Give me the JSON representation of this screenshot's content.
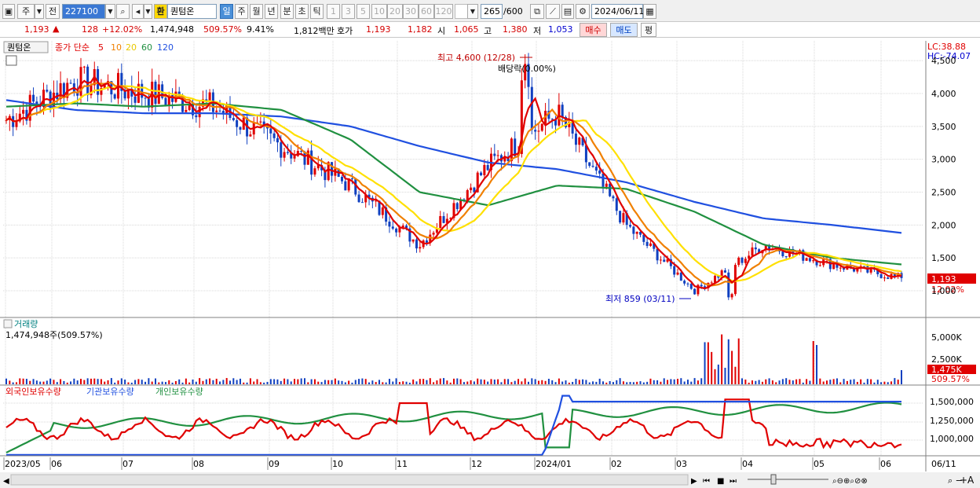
{
  "toolbar": {
    "type_label": "주",
    "prev_label": "전",
    "code_value": "227100",
    "cur_label": "환",
    "stock_name": "퀀텀온",
    "periods": [
      "일",
      "주",
      "월",
      "년",
      "분",
      "초",
      "틱"
    ],
    "selected_period": "일",
    "minutes": [
      "1",
      "3",
      "5",
      "10",
      "20",
      "30",
      "60",
      "120"
    ],
    "count_value": "265",
    "count_total": "/600",
    "date_value": "2024/06/11"
  },
  "quote": {
    "price": "1,193",
    "change": "128",
    "change_pct": "+12.02%",
    "volume": "1,474,948",
    "volume_ratio": "509.57%",
    "turnover": "9.41%",
    "amount": "1,812백만",
    "hoga_label": "호가",
    "ask": "1,193",
    "bid": "1,182",
    "open_label": "시",
    "open": "1,065",
    "high_label": "고",
    "high": "1,380",
    "low_label": "저",
    "low": "1,053",
    "buy_label": "매수",
    "sell_label": "매도",
    "eval_label": "평"
  },
  "price_panel": {
    "name_tag": "퀀텀온",
    "ma_label": "종가 단순",
    "ma_periods": [
      "5",
      "10",
      "20",
      "60",
      "120"
    ],
    "ma_colors": [
      "#e00000",
      "#f08000",
      "#ffe000",
      "#209040",
      "#2050e0"
    ],
    "lc_label": "LC:38.88",
    "hc_label": "HC:-74.07",
    "high_note": "최고 4,600 (12/28)",
    "dividend_note": "배당락(0.00%)",
    "low_note": "최저 859 (03/11)",
    "price_badge": "1,193",
    "pct_badge": "12.02%",
    "y_ticks": [
      "4,500",
      "4,000",
      "3,500",
      "3,000",
      "2,500",
      "2,000",
      "1,500",
      "1,000"
    ]
  },
  "volume_panel": {
    "title": "거래량",
    "value": "1,474,948주(509.57%)",
    "y_ticks": [
      "5,000K",
      "2,500K"
    ],
    "badge": "1,475K",
    "badge_pct": "509.57%"
  },
  "holding_panel": {
    "legend": [
      "외국인보유수량",
      "기관보유수량",
      "개인보유수량"
    ],
    "colors": [
      "#e00000",
      "#2050e0",
      "#209040"
    ],
    "y_ticks": [
      "1,500,000",
      "1,250,000",
      "1,000,000"
    ]
  },
  "x_axis": {
    "labels": [
      "2023/05",
      "06",
      "07",
      "08",
      "09",
      "10",
      "11",
      "12",
      "2024/01",
      "02",
      "03",
      "04",
      "05",
      "06"
    ],
    "right_label": "06/11"
  },
  "chart_data": {
    "type": "line",
    "title": "",
    "x": [
      "2023/05",
      "2023/06",
      "2023/07",
      "2023/08",
      "2023/09",
      "2023/10",
      "2023/11",
      "2023/12",
      "2024/01",
      "2024/02",
      "2024/03",
      "2024/04",
      "2024/05",
      "2024/06"
    ],
    "series": [
      {
        "name": "종가 단순 5",
        "values": [
          3600,
          4200,
          4000,
          3800,
          3200,
          2600,
          1700,
          2900,
          3700,
          2000,
          1000,
          1700,
          1400,
          1193
        ]
      },
      {
        "name": "종가 단순 60",
        "values": [
          3800,
          3850,
          3800,
          3850,
          3750,
          3300,
          2500,
          2300,
          2600,
          2550,
          2200,
          1700,
          1500,
          1400
        ]
      },
      {
        "name": "종가 단순 120",
        "values": [
          3900,
          3750,
          3700,
          3700,
          3650,
          3500,
          3200,
          2950,
          2850,
          2650,
          2350,
          2100,
          2000,
          1880
        ]
      }
    ],
    "price_range": [
      859,
      4600
    ],
    "last_close": 1193,
    "high": {
      "value": 4600,
      "date": "12/28"
    },
    "low": {
      "value": 859,
      "date": "03/11"
    },
    "last_volume": 1474948
  }
}
